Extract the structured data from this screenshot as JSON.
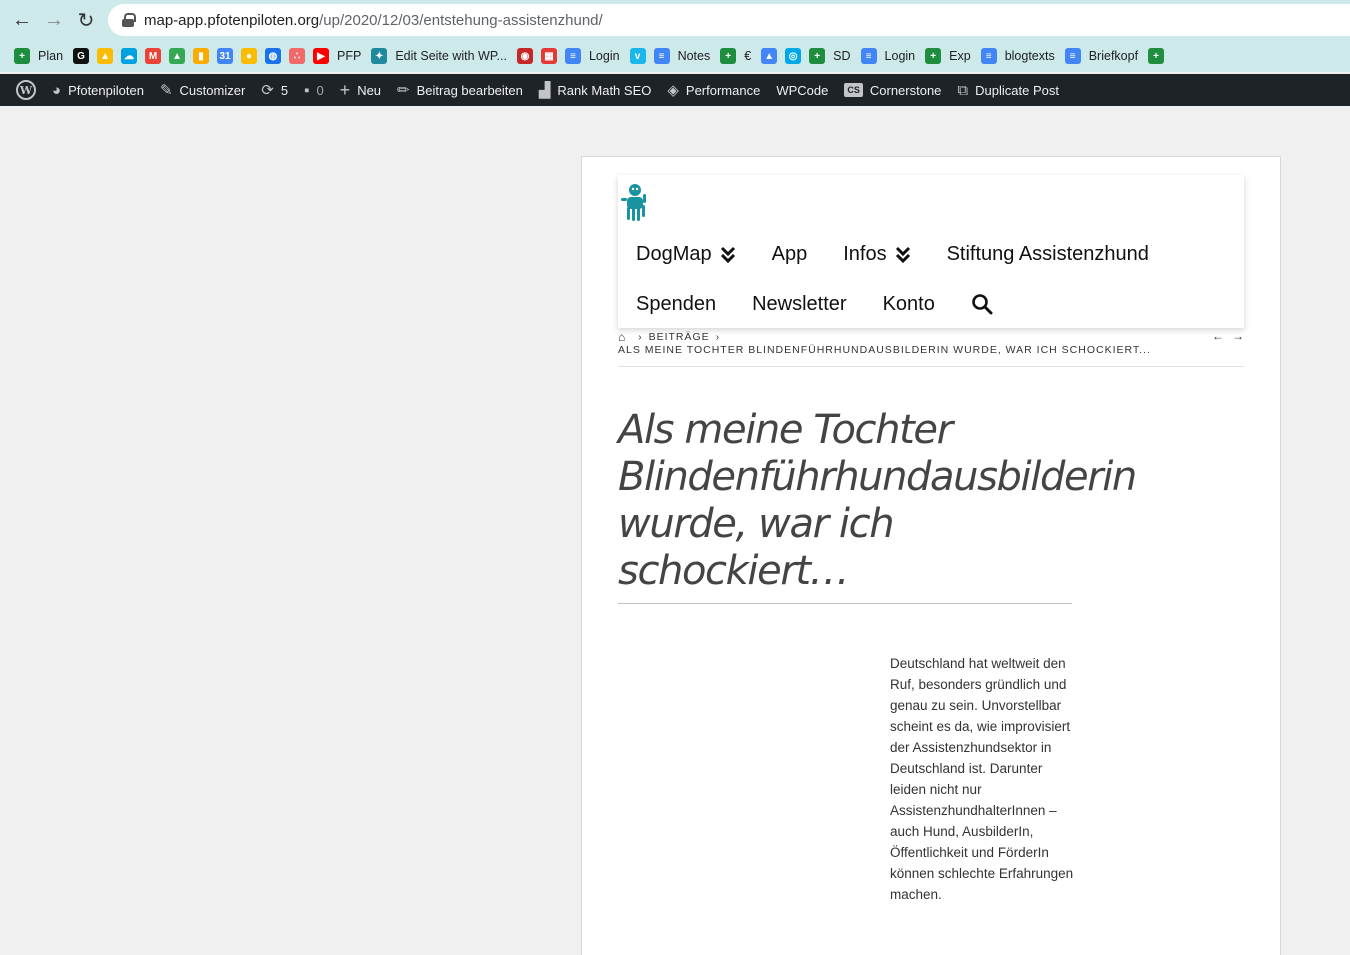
{
  "browser": {
    "url_host": "map-app.pfotenpiloten.org",
    "url_path": "/up/2020/12/03/entstehung-assistenzhund/",
    "bookmarks": [
      {
        "label": "Plan",
        "icon": "sheets-icon",
        "color": "#1e8e3e"
      },
      {
        "label": "",
        "icon": "gox-icon",
        "color": "#111111"
      },
      {
        "label": "",
        "icon": "drive-icon",
        "color": "#fbbc04"
      },
      {
        "label": "",
        "icon": "salesforce-icon",
        "color": "#00a1e0"
      },
      {
        "label": "",
        "icon": "gmail-icon",
        "color": "#ea4335"
      },
      {
        "label": "",
        "icon": "drive-icon",
        "color": "#34a853"
      },
      {
        "label": "",
        "icon": "analytics-icon",
        "color": "#f9ab00"
      },
      {
        "label": "",
        "icon": "calendar-icon",
        "color": "#4285f4"
      },
      {
        "label": "",
        "icon": "keep-icon",
        "color": "#fbbc04"
      },
      {
        "label": "",
        "icon": "globe-icon",
        "color": "#1a73e8"
      },
      {
        "label": "",
        "icon": "asana-icon",
        "color": "#f06a6a"
      },
      {
        "label": "PFP",
        "icon": "youtube-icon",
        "color": "#ff0000"
      },
      {
        "label": "Edit Seite with WP...",
        "icon": "wp-puzzle-icon",
        "color": "#1f8a9e"
      },
      {
        "label": "",
        "icon": "badge-icon",
        "color": "#c62828"
      },
      {
        "label": "",
        "icon": "grid-icon",
        "color": "#e53935"
      },
      {
        "label": "Login",
        "icon": "docs-icon",
        "color": "#4285f4"
      },
      {
        "label": "",
        "icon": "vimeo-icon",
        "color": "#1ab7ea"
      },
      {
        "label": "Notes",
        "icon": "docs-icon",
        "color": "#4285f4"
      },
      {
        "label": "€",
        "icon": "sheets-icon",
        "color": "#1e8e3e"
      },
      {
        "label": "",
        "icon": "ads-icon",
        "color": "#4285f4"
      },
      {
        "label": "",
        "icon": "pin-icon",
        "color": "#00a8e8"
      },
      {
        "label": "SD",
        "icon": "sheets-icon",
        "color": "#1e8e3e"
      },
      {
        "label": "Login",
        "icon": "docs-icon",
        "color": "#4285f4"
      },
      {
        "label": "Exp",
        "icon": "sheets-icon",
        "color": "#1e8e3e"
      },
      {
        "label": "blogtexts",
        "icon": "docs-icon",
        "color": "#4285f4"
      },
      {
        "label": "Briefkopf",
        "icon": "docs-icon",
        "color": "#4285f4"
      },
      {
        "label": "",
        "icon": "sheets-icon",
        "color": "#1e8e3e"
      }
    ]
  },
  "admin_bar": {
    "site_name": "Pfotenpiloten",
    "customizer": "Customizer",
    "updates_count": "5",
    "comments_count": "0",
    "new": "Neu",
    "edit_post": "Beitrag bearbeiten",
    "rank_math": "Rank Math SEO",
    "performance": "Performance",
    "wpcode": "WPCode",
    "cornerstone_badge": "CS",
    "cornerstone": "Cornerstone",
    "duplicate": "Duplicate Post"
  },
  "site": {
    "menu_row1": [
      "DogMap",
      "App",
      "Infos",
      "Stiftung Assistenzhund"
    ],
    "menu_row2": [
      "Spenden",
      "Newsletter",
      "Konto"
    ],
    "accent": "#1a93a0"
  },
  "breadcrumb": {
    "section": "BEITRÄGE",
    "current": "ALS MEINE TOCHTER BLINDENFÜHRHUNDAUSBILDERIN WURDE, WAR ICH SCHOCKIERT..."
  },
  "post": {
    "title": "Als meine Tochter Blindenführhundausbilderin wurde, war ich schockiert…",
    "intro": "Deutschland hat weltweit den Ruf, besonders gründlich und genau zu sein. Unvorstellbar scheint es da, wie improvisiert der Assistenzhundsektor in Deutschland ist. Darunter leiden nicht nur AssistenzhundhalterInnen – auch Hund, AusbilderIn, Öffentlichkeit und FörderIn können schlechte Erfahrungen machen."
  }
}
